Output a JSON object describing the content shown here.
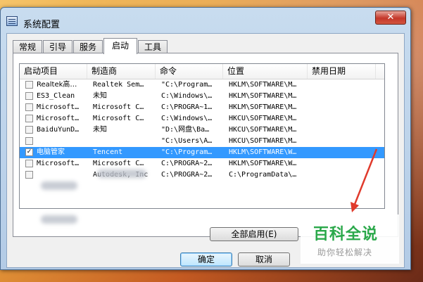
{
  "window": {
    "title": "系统配置",
    "close_label": "✕"
  },
  "tabs": [
    {
      "label": "常规"
    },
    {
      "label": "引导"
    },
    {
      "label": "服务"
    },
    {
      "label": "启动"
    },
    {
      "label": "工具"
    }
  ],
  "table": {
    "columns": [
      "启动项目",
      "制造商",
      "命令",
      "位置",
      "禁用日期"
    ],
    "rows": [
      {
        "checked": false,
        "name": "Realtek高…",
        "maker": "Realtek Sem…",
        "command": "\"C:\\Program…",
        "location": "HKLM\\SOFTWARE\\M…",
        "disabled": ""
      },
      {
        "checked": false,
        "name": "ES3_Clean",
        "maker": "未知",
        "command": "C:\\Windows\\…",
        "location": "HKLM\\SOFTWARE\\M…",
        "disabled": ""
      },
      {
        "checked": false,
        "name": "Microsoft…",
        "maker": "Microsoft C…",
        "command": "C:\\PROGRA~1…",
        "location": "HKLM\\SOFTWARE\\M…",
        "disabled": ""
      },
      {
        "checked": false,
        "name": "Microsoft…",
        "maker": "Microsoft C…",
        "command": "C:\\Windows\\…",
        "location": "HKCU\\SOFTWARE\\M…",
        "disabled": ""
      },
      {
        "checked": false,
        "name": "BaiduYunD…",
        "maker": "未知",
        "command": "\"D:\\网盘\\Ba…",
        "location": "HKCU\\SOFTWARE\\M…",
        "disabled": ""
      },
      {
        "checked": false,
        "name": "",
        "maker": "",
        "command": "\"C:\\Users\\A…",
        "location": "HKCU\\SOFTWARE\\M…",
        "disabled": ""
      },
      {
        "checked": true,
        "name": "电脑管家",
        "maker": "Tencent",
        "command": "\"C:\\Program…",
        "location": "HKLM\\SOFTWARE\\W…",
        "disabled": "",
        "selected": true
      },
      {
        "checked": false,
        "name": "Microsoft…",
        "maker": "Microsoft C…",
        "command": "C:\\PROGRA~2…",
        "location": "HKLM\\SOFTWARE\\W…",
        "disabled": ""
      },
      {
        "checked": false,
        "name": "",
        "maker": "Autodesk, Inc",
        "command": "C:\\PROGRA~2…",
        "location": "C:\\ProgramData\\…",
        "disabled": ""
      }
    ]
  },
  "buttons": {
    "enable_all": "全部启用(E)",
    "ok": "确定",
    "cancel": "取消"
  },
  "watermark": {
    "title": "百科全说",
    "subtitle": "助你轻松解决"
  }
}
